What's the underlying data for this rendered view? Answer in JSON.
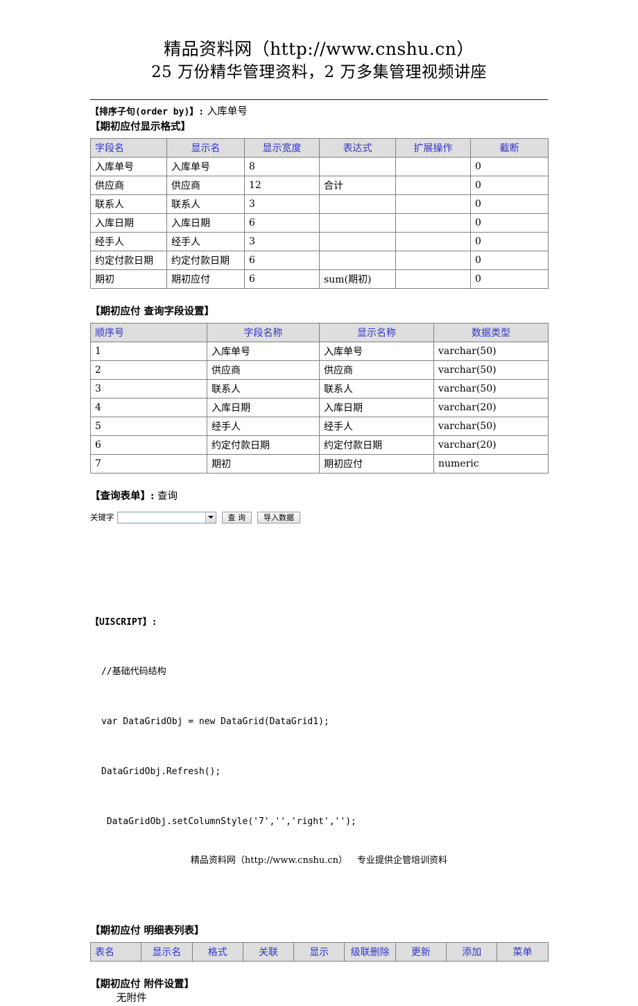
{
  "banner": {
    "line1": "精品资料网（http://www.cnshu.cn）",
    "line2": "25 万份精华管理资料，2 万多集管理视频讲座"
  },
  "order_by": {
    "label": "【排序子句(order by)】:",
    "value": "入库单号"
  },
  "display_format": {
    "title": "【期初应付显示格式】",
    "headers": [
      "字段名",
      "显示名",
      "显示宽度",
      "表达式",
      "扩展操作",
      "截断"
    ],
    "rows": [
      [
        "入库单号",
        "入库单号",
        "8",
        "",
        "",
        "0"
      ],
      [
        "供应商",
        "供应商",
        "12",
        "合计",
        "",
        "0"
      ],
      [
        "联系人",
        "联系人",
        "3",
        "",
        "",
        "0"
      ],
      [
        "入库日期",
        "入库日期",
        "6",
        "",
        "",
        "0"
      ],
      [
        "经手人",
        "经手人",
        "3",
        "",
        "",
        "0"
      ],
      [
        "约定付款日期",
        "约定付款日期",
        "6",
        "",
        "",
        "0"
      ],
      [
        "期初",
        "期初应付",
        "6",
        "sum(期初)",
        "",
        "0"
      ]
    ]
  },
  "query_fields": {
    "title": "【期初应付 查询字段设置】",
    "headers": [
      "顺序号",
      "字段名称",
      "显示名称",
      "数据类型"
    ],
    "rows": [
      [
        "1",
        "入库单号",
        "入库单号",
        "varchar(50)"
      ],
      [
        "2",
        "供应商",
        "供应商",
        "varchar(50)"
      ],
      [
        "3",
        "联系人",
        "联系人",
        "varchar(50)"
      ],
      [
        "4",
        "入库日期",
        "入库日期",
        "varchar(20)"
      ],
      [
        "5",
        "经手人",
        "经手人",
        "varchar(50)"
      ],
      [
        "6",
        "约定付款日期",
        "约定付款日期",
        "varchar(20)"
      ],
      [
        "7",
        "期初",
        "期初应付",
        "numeric"
      ]
    ]
  },
  "query_form": {
    "title_label": "【查询表单】:",
    "title_value": "查询",
    "keyword_label": "关键字",
    "keyword_value": "",
    "keyword_placeholder": "",
    "query_button": "查 询",
    "import_button": "导入数据"
  },
  "uiscript": {
    "title": "【UISCRIPT】:",
    "lines": [
      "//基础代码结构",
      "var DataGridObj = new DataGrid(DataGrid1);",
      "DataGridObj.Refresh();",
      " DataGridObj.setColumnStyle('7','','right','');"
    ]
  },
  "detail_tables": {
    "title": "【期初应付 明细表列表】",
    "headers": [
      "表名",
      "显示名",
      "格式",
      "关联",
      "显示",
      "级联删除",
      "更新",
      "添加",
      "菜单"
    ],
    "rows": []
  },
  "attachments": {
    "title": "【期初应付 附件设置】",
    "value": "无附件"
  },
  "footer": {
    "site": "精品资料网（http://www.cnshu.cn）",
    "tagline": "专业提供企管培训资料"
  },
  "colors": {
    "header_text": "#3333cc",
    "header_bg": "#dedede",
    "border": "#808080"
  }
}
